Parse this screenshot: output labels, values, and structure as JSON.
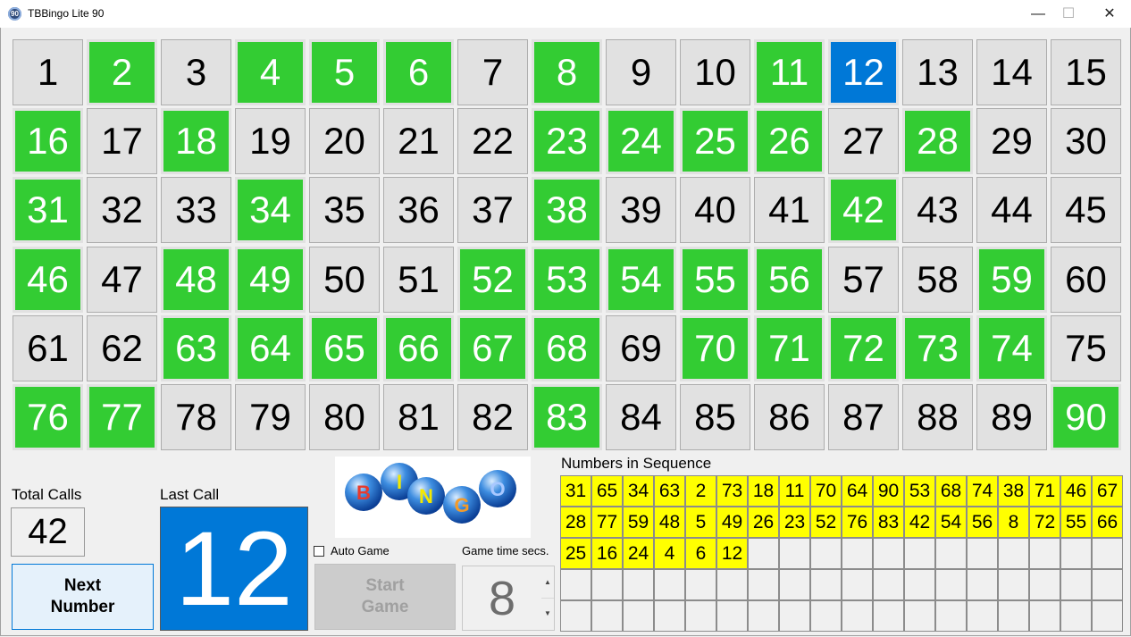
{
  "window": {
    "title": "TBBingo Lite 90",
    "icon_label": "90",
    "minimize_glyph": "—",
    "maximize_glyph": "☐",
    "close_glyph": "✕"
  },
  "board": {
    "columns": 15,
    "numbers": [
      1,
      2,
      3,
      4,
      5,
      6,
      7,
      8,
      9,
      10,
      11,
      12,
      13,
      14,
      15,
      16,
      17,
      18,
      19,
      20,
      21,
      22,
      23,
      24,
      25,
      26,
      27,
      28,
      29,
      30,
      31,
      32,
      33,
      34,
      35,
      36,
      37,
      38,
      39,
      40,
      41,
      42,
      43,
      44,
      45,
      46,
      47,
      48,
      49,
      50,
      51,
      52,
      53,
      54,
      55,
      56,
      57,
      58,
      59,
      60,
      61,
      62,
      63,
      64,
      65,
      66,
      67,
      68,
      69,
      70,
      71,
      72,
      73,
      74,
      75,
      76,
      77,
      78,
      79,
      80,
      81,
      82,
      83,
      84,
      85,
      86,
      87,
      88,
      89,
      90
    ]
  },
  "colors": {
    "called": "#33cc33",
    "last_call": "#0078d7",
    "uncalled": "#e1e1e1",
    "sequence_fill": "#ffff00"
  },
  "total_calls": {
    "label": "Total Calls",
    "value": "42"
  },
  "last_call": {
    "label": "Last Call",
    "value": "12"
  },
  "next_button": {
    "label": "Next\nNumber"
  },
  "logo": {
    "letters": [
      "B",
      "I",
      "N",
      "G",
      "O"
    ]
  },
  "auto_game": {
    "label": "Auto Game",
    "checked": false
  },
  "start_button": {
    "label": "Start\nGame",
    "enabled": false
  },
  "game_time": {
    "label": "Game time secs.",
    "value": "8",
    "up_glyph": "▲",
    "down_glyph": "▼"
  },
  "sequence": {
    "title": "Numbers in Sequence",
    "columns": 18,
    "rows": 5,
    "numbers": [
      31,
      65,
      34,
      63,
      2,
      73,
      18,
      11,
      70,
      64,
      90,
      53,
      68,
      74,
      38,
      71,
      46,
      67,
      28,
      77,
      59,
      48,
      5,
      49,
      26,
      23,
      52,
      76,
      83,
      42,
      54,
      56,
      8,
      72,
      55,
      66,
      25,
      16,
      24,
      4,
      6,
      12
    ]
  }
}
